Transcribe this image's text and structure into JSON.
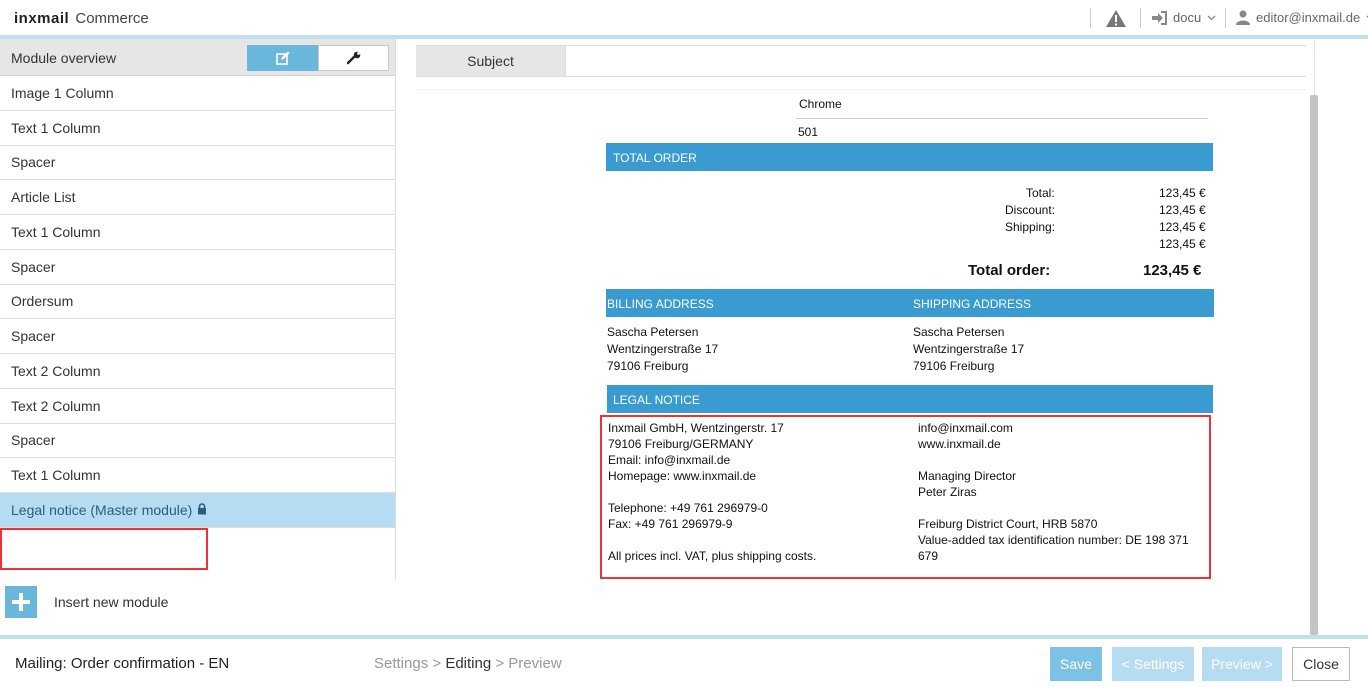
{
  "header": {
    "brand": "inxmail",
    "product": "Commerce",
    "docu_label": "docu",
    "user_label": "editor@inxmail.de"
  },
  "left_panel": {
    "title": "Module overview",
    "modules": [
      {
        "label": "Image 1 Column"
      },
      {
        "label": "Text 1 Column"
      },
      {
        "label": "Spacer"
      },
      {
        "label": "Article List"
      },
      {
        "label": "Text 1 Column"
      },
      {
        "label": "Spacer"
      },
      {
        "label": "Ordersum"
      },
      {
        "label": "Spacer"
      },
      {
        "label": "Text 2 Column"
      },
      {
        "label": "Text 2 Column"
      },
      {
        "label": "Spacer"
      },
      {
        "label": "Text 1 Column"
      },
      {
        "label": "Legal notice (Master module)"
      }
    ],
    "insert_label": "Insert new module"
  },
  "editor": {
    "subject_label": "Subject",
    "subject_value": ""
  },
  "email": {
    "browser_label": "Chrome",
    "number_value": "501",
    "total_order_heading": "TOTAL ORDER",
    "totals": {
      "total_label": "Total:",
      "total_value": "123,45 €",
      "discount_label": "Discount:",
      "discount_value": "123,45 €",
      "shipping_label": "Shipping:",
      "shipping_value": "123,45 €",
      "extra_value": "123,45 €",
      "grand_label": "Total order:",
      "grand_value": "123,45 €"
    },
    "billing_heading": "BILLING ADDRESS",
    "shipping_heading": "SHIPPING ADDRESS",
    "billing": {
      "name": "Sascha Petersen",
      "street": "Wentzingerstraße 17",
      "city": "79106 Freiburg"
    },
    "shipping": {
      "name": "Sascha Petersen",
      "street": "Wentzingerstraße 17",
      "city": "79106 Freiburg"
    },
    "legal_heading": "LEGAL NOTICE",
    "legal_left": [
      "Inxmail GmbH, Wentzingerstr. 17",
      "79106 Freiburg/GERMANY",
      "Email: info@inxmail.de",
      "Homepage: www.inxmail.de",
      "Telephone: +49 761 296979-0",
      "Fax: +49 761 296979-9",
      "All prices incl. VAT, plus shipping costs."
    ],
    "legal_right": [
      "info@inxmail.com",
      "www.inxmail.de",
      "Managing Director",
      "Peter Ziras",
      "Freiburg District Court, HRB 5870",
      "Value-added tax identification number: DE 198 371",
      "679"
    ]
  },
  "footer": {
    "mailing_title": "Mailing: Order confirmation - EN",
    "step_settings": "Settings",
    "step_editing": "Editing",
    "step_preview": "Preview",
    "step_sep": ">",
    "save_label": "Save",
    "settings_label": "< Settings",
    "preview_label": "Preview >",
    "close_label": "Close"
  },
  "colors": {
    "accent": "#3a9bd0",
    "selected": "#b5dcf0",
    "highlight": "#e33333"
  }
}
